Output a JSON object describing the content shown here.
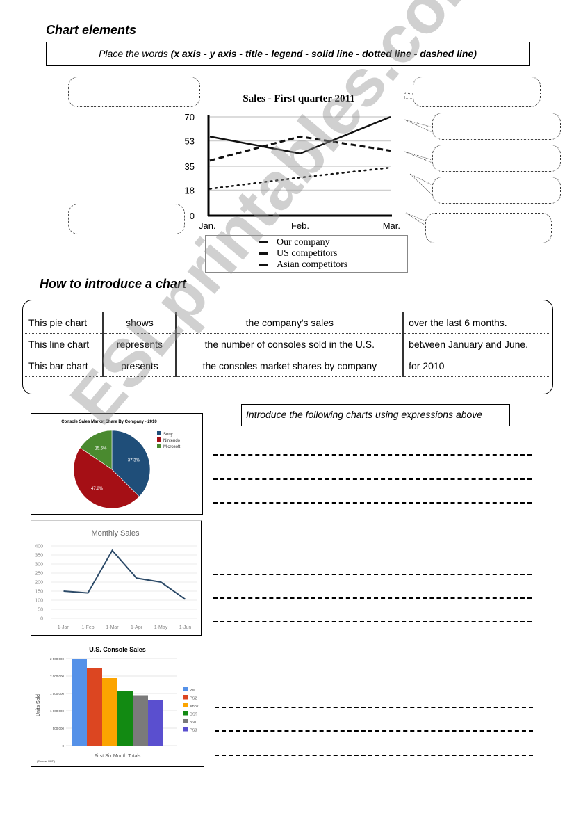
{
  "section1": {
    "heading": "Chart elements",
    "instruction_prefix": "Place the words ",
    "instruction_words": "(x axis - y axis - title - legend - solid line - dotted line - dashed line)"
  },
  "callout_count": 7,
  "chart_data": [
    {
      "type": "line",
      "title": "Sales - First quarter 2011",
      "categories": [
        "Jan.",
        "Feb.",
        "Mar."
      ],
      "yticks": [
        0,
        18,
        35,
        53,
        70
      ],
      "ylim": [
        0,
        70
      ],
      "grid": true,
      "series": [
        {
          "name": "Our company",
          "style": "solid",
          "values": [
            56,
            44,
            70
          ]
        },
        {
          "name": "US competitors",
          "style": "dashed",
          "values": [
            39,
            56,
            46
          ]
        },
        {
          "name": "Asian competitors",
          "style": "dotted",
          "values": [
            19,
            27,
            34
          ]
        }
      ],
      "legend_position": "bottom"
    },
    {
      "type": "pie",
      "title": "Console Sales Market Share By Company - 2010",
      "slices": [
        {
          "label": "Sony",
          "value": 37.3,
          "text": "37.3%",
          "color": "#1f4e79"
        },
        {
          "label": "Nintendo",
          "value": 47.2,
          "text": "47.2%",
          "color": "#a50f15"
        },
        {
          "label": "Microsoft",
          "value": 15.6,
          "text": "15.6%",
          "color": "#4a8a2f"
        }
      ],
      "legend_position": "right"
    },
    {
      "type": "line",
      "title": "Monthly Sales",
      "categories": [
        "1-Jan",
        "1-Feb",
        "1-Mar",
        "1-Apr",
        "1-May",
        "1-Jun"
      ],
      "values": [
        150,
        140,
        375,
        222,
        200,
        105
      ],
      "yticks": [
        0,
        50,
        100,
        150,
        200,
        250,
        300,
        350,
        400
      ],
      "ylim": [
        0,
        400
      ],
      "grid": true,
      "color": "#2c4a68"
    },
    {
      "type": "bar",
      "title": "U.S. Console Sales",
      "ylabel": "Units Sold",
      "xlabel": "First Six Month Totals",
      "source": "(Source: NPD)",
      "yticks": [
        0,
        500000,
        1000000,
        1500000,
        2000000,
        2500000
      ],
      "ytick_labels": [
        "0",
        "500 000",
        "1 000 000",
        "1 500 000",
        "2 000 000",
        "2 500 000"
      ],
      "ylim": [
        0,
        2500000
      ],
      "categories": [
        "Wii",
        "PS2",
        "Xbox",
        "DS?",
        "360",
        "PS3"
      ],
      "values": [
        2480000,
        2230000,
        1940000,
        1580000,
        1430000,
        1300000
      ],
      "colors": [
        "#5591e8",
        "#dc4621",
        "#fca400",
        "#128a12",
        "#7a7a7a",
        "#5a4fcf"
      ],
      "legend_position": "right"
    }
  ],
  "section2": {
    "heading": "How to introduce a chart",
    "rows": [
      [
        "This pie chart",
        "shows",
        "the company's sales",
        "over the last 6 months."
      ],
      [
        "This line chart",
        "represents",
        "the number of consoles sold in the U.S.",
        "between January and June."
      ],
      [
        "This  bar chart",
        "presents",
        "the consoles market shares by company",
        "for 2010"
      ]
    ]
  },
  "section3": {
    "instruction": "Introduce the following charts using expressions above"
  },
  "watermark": "ESLprintables.com"
}
